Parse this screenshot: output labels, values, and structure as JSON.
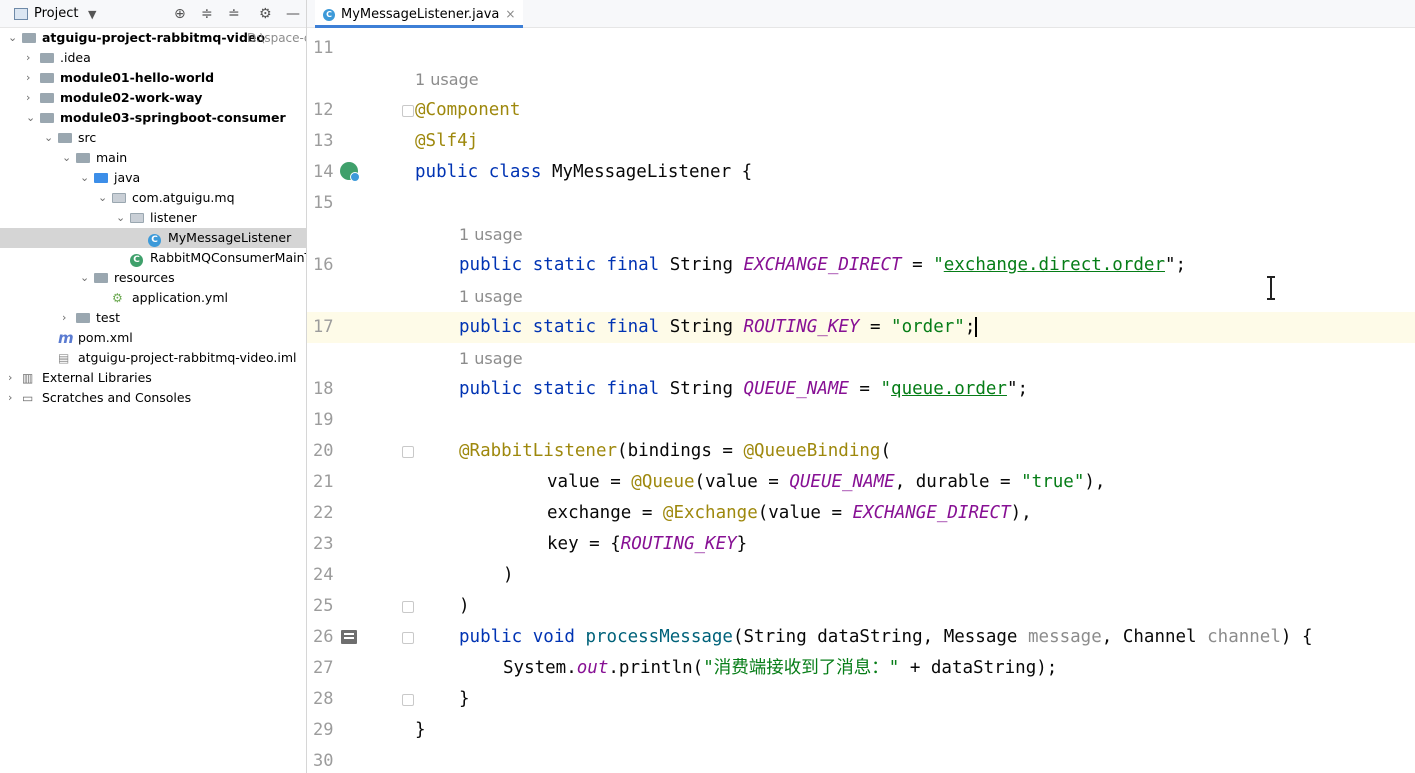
{
  "project_panel": {
    "title": "Project",
    "tree": [
      {
        "label": "atguigu-project-rabbitmq-video",
        "hint": "D:\\space-c",
        "bold": true,
        "arrow": "down",
        "icon": "folder",
        "depth": 0
      },
      {
        "label": ".idea",
        "bold": false,
        "arrow": "right",
        "icon": "folder",
        "depth": 1
      },
      {
        "label": "module01-hello-world",
        "bold": true,
        "arrow": "right",
        "icon": "folder",
        "depth": 1
      },
      {
        "label": "module02-work-way",
        "bold": true,
        "arrow": "right",
        "icon": "folder",
        "depth": 1
      },
      {
        "label": "module03-springboot-consumer",
        "bold": true,
        "arrow": "down",
        "icon": "folder",
        "depth": 1
      },
      {
        "label": "src",
        "bold": false,
        "arrow": "down",
        "icon": "folder",
        "depth": 2
      },
      {
        "label": "main",
        "bold": false,
        "arrow": "down",
        "icon": "folder",
        "depth": 3
      },
      {
        "label": "java",
        "bold": false,
        "arrow": "down",
        "icon": "folder-blue",
        "depth": 4
      },
      {
        "label": "com.atguigu.mq",
        "bold": false,
        "arrow": "down",
        "icon": "package",
        "depth": 5
      },
      {
        "label": "listener",
        "bold": false,
        "arrow": "down",
        "icon": "package",
        "depth": 6
      },
      {
        "label": "MyMessageListener",
        "bold": false,
        "arrow": "",
        "icon": "class",
        "depth": 7,
        "selected": true
      },
      {
        "label": "RabbitMQConsumerMainT",
        "bold": false,
        "arrow": "",
        "icon": "spring-class",
        "depth": 6
      },
      {
        "label": "resources",
        "bold": false,
        "arrow": "down",
        "icon": "folder-res",
        "depth": 4
      },
      {
        "label": "application.yml",
        "bold": false,
        "arrow": "",
        "icon": "yml",
        "depth": 5
      },
      {
        "label": "test",
        "bold": false,
        "arrow": "right",
        "icon": "folder",
        "depth": 3
      },
      {
        "label": "pom.xml",
        "bold": false,
        "arrow": "",
        "icon": "maven",
        "depth": 2
      },
      {
        "label": "atguigu-project-rabbitmq-video.iml",
        "bold": false,
        "arrow": "",
        "icon": "iml",
        "depth": 2
      },
      {
        "label": "External Libraries",
        "bold": false,
        "arrow": "right",
        "icon": "libraries",
        "depth": 0
      },
      {
        "label": "Scratches and Consoles",
        "bold": false,
        "arrow": "right",
        "icon": "scratches",
        "depth": 0
      }
    ]
  },
  "tab": {
    "label": "MyMessageListener.java",
    "close": "×"
  },
  "editor": {
    "hint_usage": "1 usage",
    "lines": {
      "l11": "11",
      "l12": "12",
      "l13": "13",
      "l14": "14",
      "l15": "15",
      "l16": "16",
      "l17": "17",
      "l18": "18",
      "l19": "19",
      "l20": "20",
      "l21": "21",
      "l22": "22",
      "l23": "23",
      "l24": "24",
      "l25": "25",
      "l26": "26",
      "l27": "27",
      "l28": "28",
      "l29": "29",
      "l30": "30"
    },
    "code": {
      "component": "@Component",
      "slf4j": "@Slf4j",
      "kw_public": "public",
      "kw_class": "class",
      "class_name": "MyMessageListener",
      "open_brace": " {",
      "kw_static": "static",
      "kw_final": "final",
      "kw_void": "void",
      "type_string": "String",
      "exchange_direct": "EXCHANGE_DIRECT",
      "routing_key": "ROUTING_KEY",
      "queue_name": "QUEUE_NAME",
      "eq": " = ",
      "exchange_value_open": "\"",
      "exchange_value_text": "exchange.direct.order",
      "string_close_semicolon": "\";",
      "routing_value": "\"order\"",
      "semicolon": ";",
      "queue_value_text": "queue.order",
      "rabbit_listener": "@RabbitListener",
      "bindings_text": "(bindings = ",
      "queue_binding": "@QueueBinding",
      "paren_open": "(",
      "value_eq": "value = ",
      "queue_ann": "@Queue",
      "value_inner": "(value = ",
      "durable_text": ", durable = ",
      "true_value": "\"true\"",
      "close_paren_comma": "),",
      "exchange_eq": "exchange = ",
      "exchange_ann": "@Exchange",
      "key_eq": "key = {",
      "close_brace": "}",
      "close_paren": ")",
      "method_name": "processMessage",
      "params_1": "(String dataString, Message ",
      "param_message": "message",
      "params_2": ", Channel ",
      "param_channel": "channel",
      "params_3": ") {",
      "system_text": "System.",
      "out_field": "out",
      "println_text": ".println(",
      "println_str": "\"消费端接收到了消息：\"",
      "println_rest": " + dataString);"
    }
  }
}
